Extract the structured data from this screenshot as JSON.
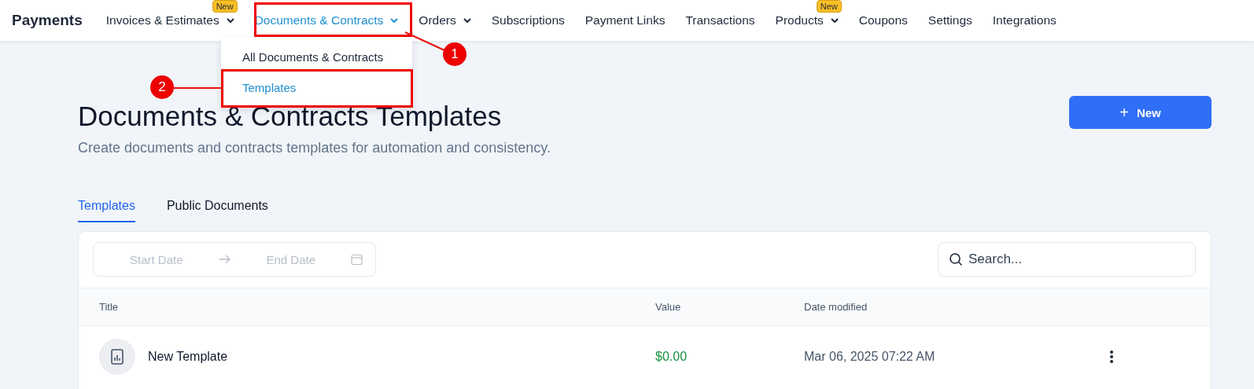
{
  "app_title": "Payments",
  "nav": [
    {
      "label": "Invoices & Estimates",
      "dropdown": true,
      "badge": "New",
      "selected": false
    },
    {
      "label": "Documents & Contracts",
      "dropdown": true,
      "selected": true
    },
    {
      "label": "Orders",
      "dropdown": true,
      "selected": false
    },
    {
      "label": "Subscriptions",
      "dropdown": false,
      "selected": false
    },
    {
      "label": "Payment Links",
      "dropdown": false,
      "selected": false
    },
    {
      "label": "Transactions",
      "dropdown": false,
      "selected": false
    },
    {
      "label": "Products",
      "dropdown": true,
      "badge": "New",
      "selected": false
    },
    {
      "label": "Coupons",
      "dropdown": false,
      "selected": false
    },
    {
      "label": "Settings",
      "dropdown": false,
      "selected": false
    },
    {
      "label": "Integrations",
      "dropdown": false,
      "selected": false
    }
  ],
  "dropdown_menu": [
    {
      "label": "All Documents & Contracts",
      "selected": false
    },
    {
      "label": "Templates",
      "selected": true
    }
  ],
  "annotations": [
    {
      "number": "1"
    },
    {
      "number": "2"
    }
  ],
  "page": {
    "title": "Documents & Contracts Templates",
    "subtitle": "Create documents and contracts templates for automation and consistency.",
    "new_button": {
      "icon": "+",
      "label": "New"
    }
  },
  "tabs": [
    {
      "label": "Templates",
      "selected": true
    },
    {
      "label": "Public Documents",
      "selected": false
    }
  ],
  "filters": {
    "start_date": {
      "placeholder": "Start Date"
    },
    "end_date": {
      "placeholder": "End Date"
    },
    "search": {
      "placeholder": "Search..."
    }
  },
  "table": {
    "columns": [
      "Title",
      "Value",
      "Date modified"
    ],
    "rows": [
      {
        "title": "New Template",
        "value": "$0.00",
        "date_modified": "Mar 06, 2025 07:22 AM"
      }
    ]
  }
}
